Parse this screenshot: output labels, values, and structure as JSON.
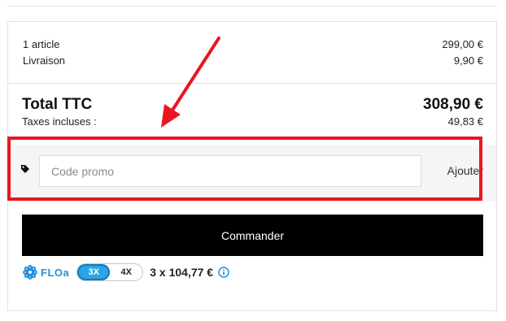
{
  "summary": {
    "article_label": "1 article",
    "article_price": "299,00 €",
    "shipping_label": "Livraison",
    "shipping_price": "9,90 €"
  },
  "total": {
    "label": "Total TTC",
    "value": "308,90 €",
    "tax_label": "Taxes incluses :",
    "tax_value": "49,83 €"
  },
  "promo": {
    "placeholder": "Code promo",
    "value": "",
    "add_label": "Ajouter"
  },
  "checkout": {
    "order_label": "Commander"
  },
  "floa": {
    "brand": "FLOa",
    "options": [
      "3X",
      "4X"
    ],
    "selected": "3X",
    "installment": "3 x 104,77 €"
  },
  "colors": {
    "highlight": "#e8161f",
    "floa_blue": "#1e8fe0",
    "toggle_active": "#2aa6e8",
    "order_button": "#000000"
  },
  "icons": {
    "promo": "tag-icon",
    "floa": "floa-logo-icon",
    "info": "info-icon",
    "annotation": "red-arrow-icon"
  }
}
